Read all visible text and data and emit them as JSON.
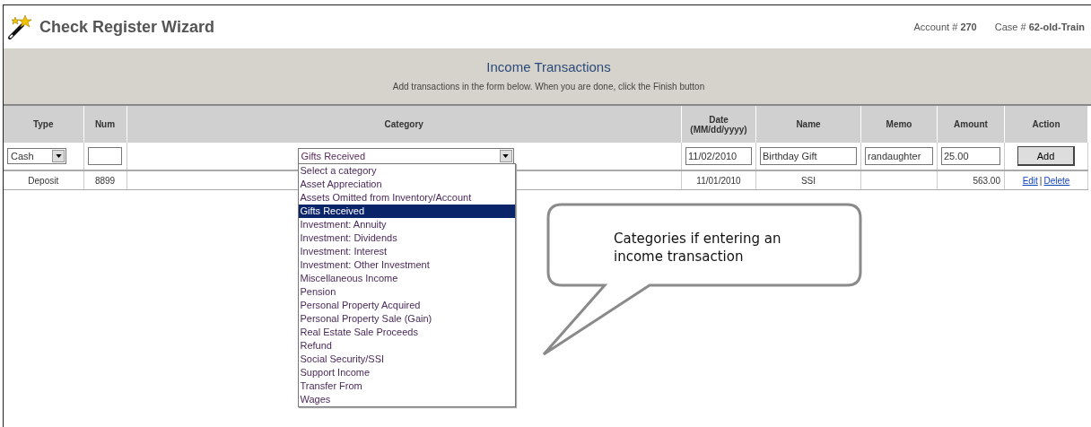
{
  "header": {
    "title": "Check Register Wizard",
    "account": "Account # **270**",
    "case": "Case # **62-old-Train**"
  },
  "band": {
    "title": "Income Transactions",
    "subtitle": "Add transactions in the form below. When you are done, click the Finish button"
  },
  "columns": [
    "Type",
    "Num",
    "Category",
    "Date\n(MM/dd/yyyy)",
    "Name",
    "Memo",
    "Amount",
    "Action"
  ],
  "form": {
    "type": "Cash",
    "category": "Gifts Received",
    "date": "11/02/2010",
    "name": "Birthday Gift",
    "memo": "randaughter",
    "amount": "25.00",
    "button": "Add"
  },
  "rows": [
    {
      "type": "Deposit",
      "num": "8899",
      "date": "11/01/2010",
      "name": "SSI",
      "amount": "563.00",
      "actions": [
        "Edit",
        "Delete"
      ],
      "separator": "|"
    }
  ],
  "category_list": [
    {
      "label": "Select a category",
      "selected": false
    },
    {
      "label": "Asset Appreciation",
      "selected": false
    },
    {
      "label": "Assets Omitted from Inventory/Account",
      "selected": false
    },
    {
      "label": "Gifts Received",
      "selected": true
    },
    {
      "label": "Investment: Annuity",
      "selected": false
    },
    {
      "label": "Investment: Dividends",
      "selected": false
    },
    {
      "label": "Investment: Interest",
      "selected": false
    },
    {
      "label": "Investment: Other Investment",
      "selected": false
    },
    {
      "label": "Miscellaneous Income",
      "selected": false
    },
    {
      "label": "Pension",
      "selected": false
    },
    {
      "label": "Personal Property Acquired",
      "selected": false
    },
    {
      "label": "Personal Property Sale (Gain)",
      "selected": false
    },
    {
      "label": "Real Estate Sale Proceeds",
      "selected": false
    },
    {
      "label": "Refund",
      "selected": false
    },
    {
      "label": "Social Security/SSI",
      "selected": false
    },
    {
      "label": "Support Income",
      "selected": false
    },
    {
      "label": "Transfer From",
      "selected": false
    },
    {
      "label": "Wages",
      "selected": false
    }
  ],
  "callout": {
    "text": "Categories if entering an income transaction"
  }
}
